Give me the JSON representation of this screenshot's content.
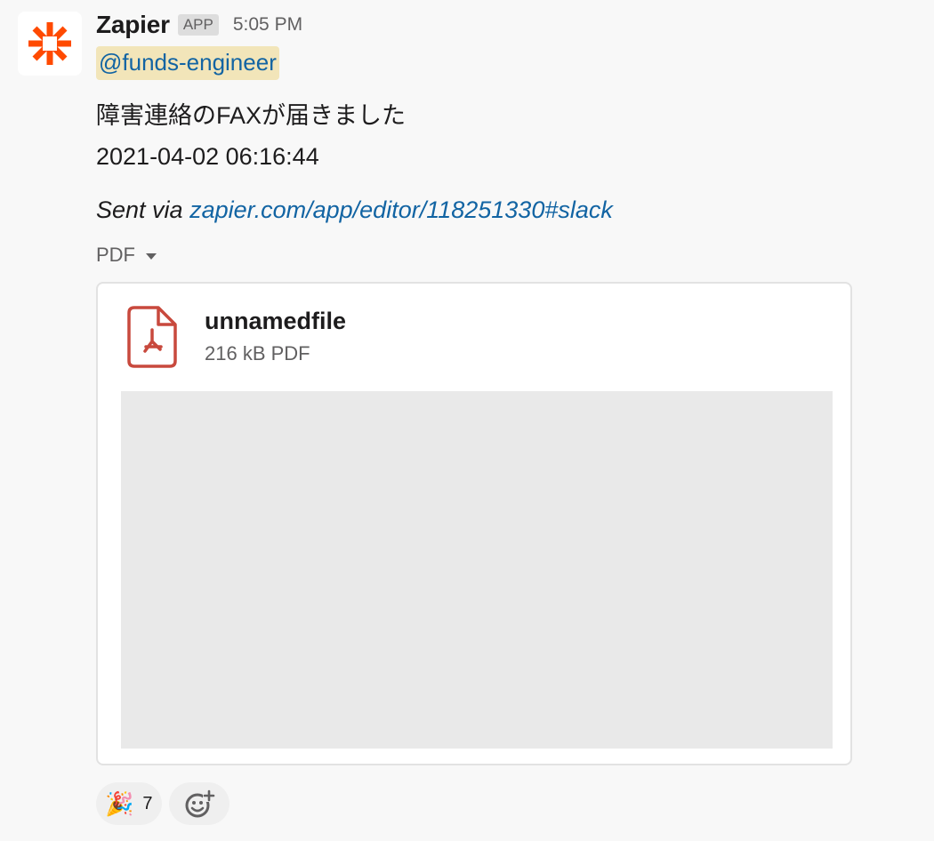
{
  "message": {
    "sender": "Zapier",
    "badge": "APP",
    "time": "5:05 PM",
    "mention": "@funds-engineer",
    "lines": [
      "障害連絡のFAXが届きました",
      "2021-04-02 06:16:44"
    ],
    "sent_via_prefix": "Sent via ",
    "sent_via_link": "zapier.com/app/editor/118251330#slack"
  },
  "file": {
    "toggle_label": "PDF",
    "name": "unnamedfile",
    "meta": "216 kB PDF"
  },
  "reactions": [
    {
      "emoji": "🎉",
      "icon": "party-popper-icon",
      "count": "7"
    }
  ],
  "add_reaction_icon": "add-emoji-icon",
  "colors": {
    "brand": "#ff4a00",
    "link": "#1264a3",
    "mention_bg": "#f2e5b9",
    "pdf_icon": "#c8493d"
  }
}
